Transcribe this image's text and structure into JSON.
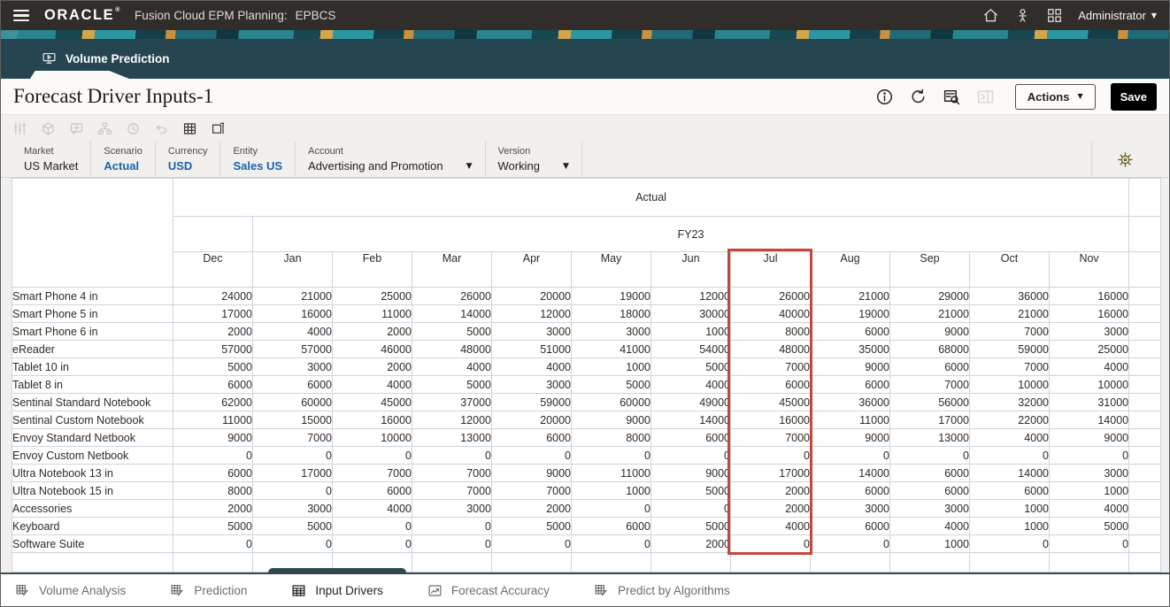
{
  "topbar": {
    "brand": "ORACLE",
    "brand_mark": "®",
    "product": "Fusion Cloud EPM Planning:",
    "environment": "EPBCS",
    "user": "Administrator"
  },
  "nav": {
    "tab_label": "Volume Prediction"
  },
  "page": {
    "title": "Forecast Driver Inputs-1",
    "actions_label": "Actions",
    "save_label": "Save",
    "header_icons": [
      {
        "name": "info-icon",
        "enabled": true
      },
      {
        "name": "refresh-icon",
        "enabled": true
      },
      {
        "name": "grid-search-icon",
        "enabled": true
      },
      {
        "name": "side-panel-icon",
        "enabled": false
      }
    ]
  },
  "toolbar": {
    "icons": [
      {
        "name": "filter-sliders-icon",
        "enabled": false
      },
      {
        "name": "cube-icon",
        "enabled": false
      },
      {
        "name": "comment-add-icon",
        "enabled": false
      },
      {
        "name": "hierarchy-icon",
        "enabled": false
      },
      {
        "name": "history-icon",
        "enabled": false
      },
      {
        "name": "undo-icon",
        "enabled": false
      },
      {
        "name": "grid-view-icon",
        "enabled": true
      },
      {
        "name": "form-layout-icon",
        "enabled": true
      }
    ]
  },
  "pov": {
    "items": [
      {
        "label": "Market",
        "value": "US Market",
        "link": false,
        "dropdown": false
      },
      {
        "label": "Scenario",
        "value": "Actual",
        "link": true,
        "dropdown": false
      },
      {
        "label": "Currency",
        "value": "USD",
        "link": true,
        "dropdown": false
      },
      {
        "label": "Entity",
        "value": "Sales US",
        "link": true,
        "dropdown": false
      },
      {
        "label": "Account",
        "value": "Advertising and Promotion",
        "link": false,
        "dropdown": true
      },
      {
        "label": "Version",
        "value": "Working",
        "link": false,
        "dropdown": true
      }
    ]
  },
  "grid": {
    "scenario_header": "Actual",
    "year_header": "FY23",
    "months": [
      "Dec",
      "Jan",
      "Feb",
      "Mar",
      "Apr",
      "May",
      "Jun",
      "Jul",
      "Aug",
      "Sep",
      "Oct",
      "Nov"
    ],
    "highlighted_month": "Jul",
    "highlight_color": "#c5473a",
    "rows": [
      {
        "name": "Smart Phone 4 in",
        "values": [
          24000,
          21000,
          25000,
          26000,
          20000,
          19000,
          12000,
          26000,
          21000,
          29000,
          36000,
          16000
        ]
      },
      {
        "name": "Smart Phone 5 in",
        "values": [
          17000,
          16000,
          11000,
          14000,
          12000,
          18000,
          30000,
          40000,
          19000,
          21000,
          21000,
          16000
        ]
      },
      {
        "name": "Smart Phone 6 in",
        "values": [
          2000,
          4000,
          2000,
          5000,
          3000,
          3000,
          1000,
          8000,
          6000,
          9000,
          7000,
          3000
        ]
      },
      {
        "name": "eReader",
        "values": [
          57000,
          57000,
          46000,
          48000,
          51000,
          41000,
          54000,
          48000,
          35000,
          68000,
          59000,
          25000
        ]
      },
      {
        "name": "Tablet 10 in",
        "values": [
          5000,
          3000,
          2000,
          4000,
          4000,
          1000,
          5000,
          7000,
          9000,
          6000,
          7000,
          4000
        ]
      },
      {
        "name": "Tablet 8 in",
        "values": [
          6000,
          6000,
          4000,
          5000,
          3000,
          5000,
          4000,
          6000,
          6000,
          7000,
          10000,
          10000
        ]
      },
      {
        "name": "Sentinal Standard Notebook",
        "values": [
          62000,
          60000,
          45000,
          37000,
          59000,
          60000,
          49000,
          45000,
          36000,
          56000,
          32000,
          31000
        ]
      },
      {
        "name": "Sentinal Custom Notebook",
        "values": [
          11000,
          15000,
          16000,
          12000,
          20000,
          9000,
          14000,
          16000,
          11000,
          17000,
          22000,
          14000
        ]
      },
      {
        "name": "Envoy Standard Netbook",
        "values": [
          9000,
          7000,
          10000,
          13000,
          6000,
          8000,
          6000,
          7000,
          9000,
          13000,
          4000,
          9000
        ]
      },
      {
        "name": "Envoy Custom Netbook",
        "values": [
          0,
          0,
          0,
          0,
          0,
          0,
          0,
          0,
          0,
          0,
          0,
          0
        ]
      },
      {
        "name": "Ultra Notebook 13 in",
        "values": [
          6000,
          17000,
          7000,
          7000,
          9000,
          11000,
          9000,
          17000,
          14000,
          6000,
          14000,
          3000
        ]
      },
      {
        "name": "Ultra Notebook 15 in",
        "values": [
          8000,
          0,
          6000,
          7000,
          7000,
          1000,
          5000,
          2000,
          6000,
          6000,
          6000,
          1000
        ]
      },
      {
        "name": "Accessories",
        "values": [
          2000,
          3000,
          4000,
          3000,
          2000,
          0,
          0,
          2000,
          3000,
          3000,
          1000,
          4000
        ]
      },
      {
        "name": "Keyboard",
        "values": [
          5000,
          5000,
          0,
          0,
          5000,
          6000,
          5000,
          4000,
          6000,
          4000,
          1000,
          5000
        ]
      },
      {
        "name": "Software Suite",
        "values": [
          0,
          0,
          0,
          0,
          0,
          0,
          2000,
          0,
          0,
          1000,
          0,
          0
        ]
      }
    ]
  },
  "bottom_tabs": [
    {
      "label": "Volume Analysis",
      "icon": "grid-pencil-icon",
      "active": false
    },
    {
      "label": "Prediction",
      "icon": "grid-pencil-icon",
      "active": false
    },
    {
      "label": "Input Drivers",
      "icon": "table-icon",
      "active": true
    },
    {
      "label": "Forecast Accuracy",
      "icon": "accuracy-icon",
      "active": false
    },
    {
      "label": "Predict by Algorithms",
      "icon": "grid-pencil-icon",
      "active": false
    }
  ]
}
